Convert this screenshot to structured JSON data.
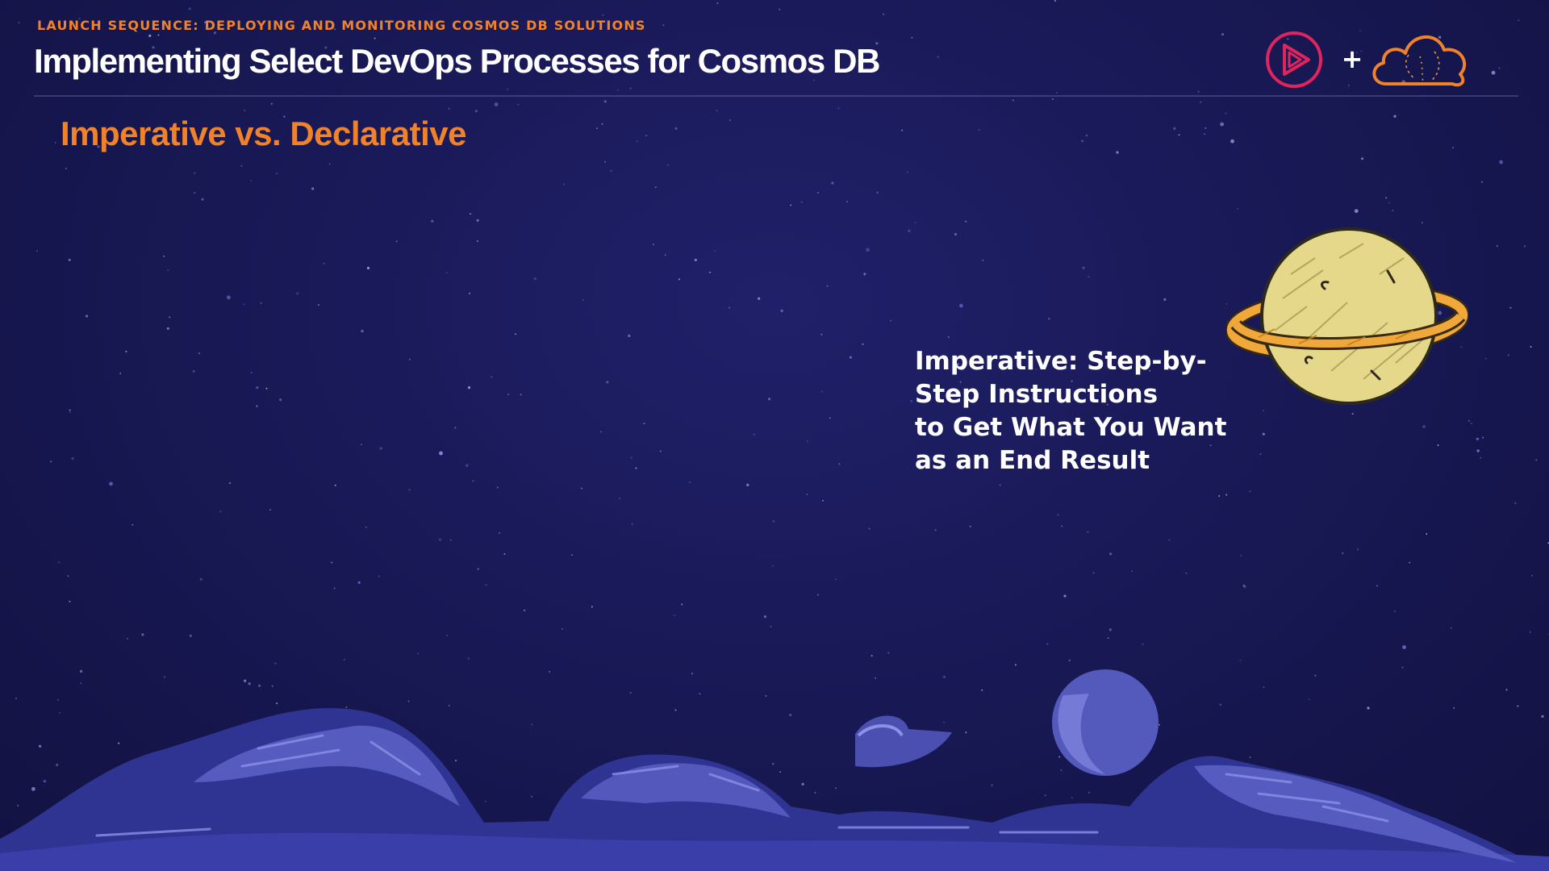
{
  "header": {
    "eyebrow": "LAUNCH SEQUENCE: DEPLOYING AND MONITORING COSMOS DB SOLUTIONS",
    "title": "Implementing Select DevOps Processes for Cosmos DB",
    "logos": {
      "left_icon": "pluralsight-play-icon",
      "separator": "+",
      "right_icon": "cloud-icon"
    }
  },
  "slide": {
    "heading": "Imperative vs. Declarative",
    "callout_lines": [
      "Imperative: Step-by-",
      "Step Instructions",
      "to Get What You Want",
      "as an End Result"
    ]
  },
  "colors": {
    "background": "#191957",
    "accent": "#f0822a",
    "text": "#ffffff",
    "brand_pink": "#e0245e",
    "planet": "#e6d88a",
    "ring": "#f0a83a",
    "terrain": "#5a5fc4"
  }
}
